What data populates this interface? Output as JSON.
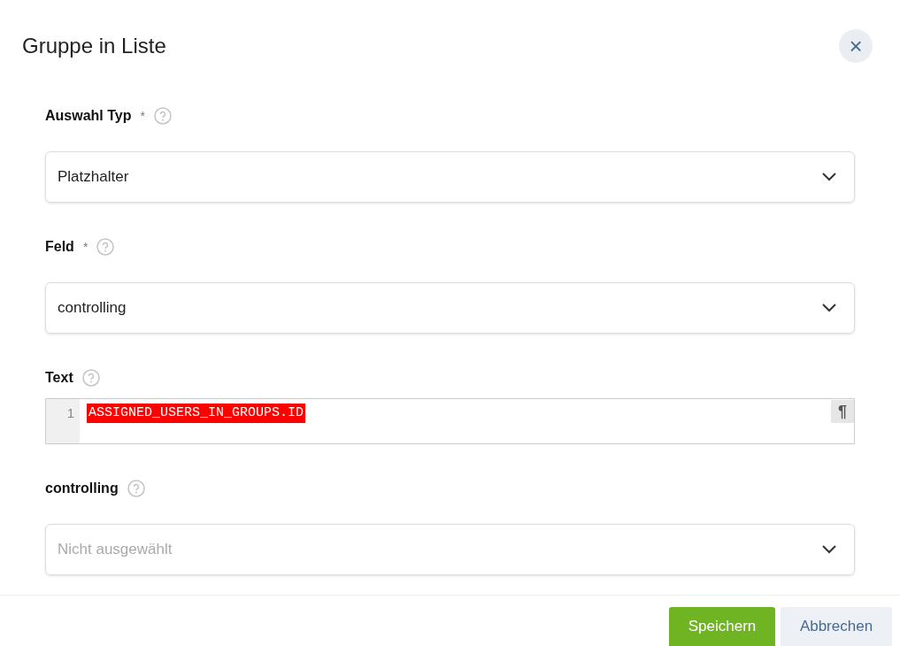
{
  "dialog": {
    "title": "Gruppe in Liste",
    "close": "×"
  },
  "fields": [
    {
      "kind": "select",
      "label": "Auswahl Typ",
      "required_mark": "*",
      "value": "Platzhalter"
    },
    {
      "kind": "select",
      "label": "Feld",
      "required_mark": "*",
      "value": "controlling"
    },
    {
      "kind": "code",
      "label": "Text",
      "line_number": "1",
      "code": "ASSIGNED_USERS_IN_GROUPS.ID",
      "pilcrow": "¶"
    },
    {
      "kind": "select",
      "label": "controlling",
      "placeholder": "Nicht ausgewählt"
    }
  ],
  "buttons": [
    {
      "kind": "primary",
      "label": "Speichern"
    },
    {
      "kind": "secondary",
      "label": "Abbrechen"
    }
  ]
}
